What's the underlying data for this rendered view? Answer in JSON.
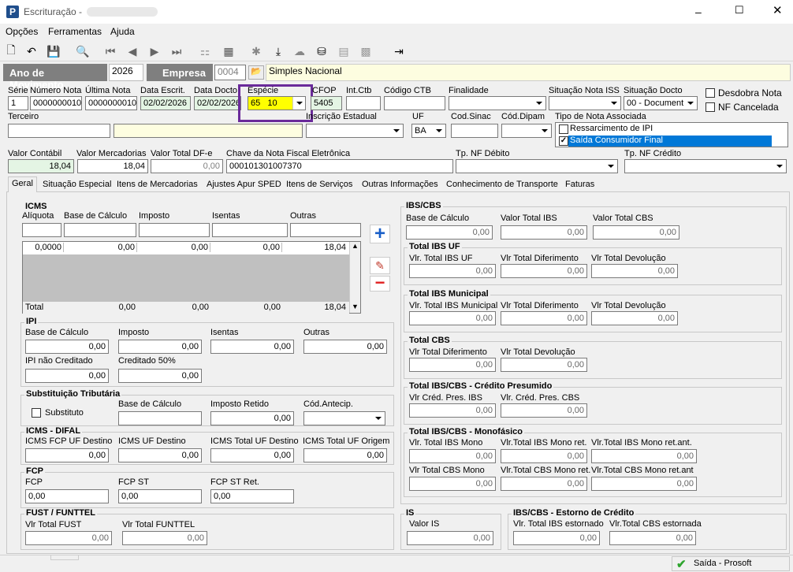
{
  "window": {
    "title": "Escrituração -"
  },
  "menu": [
    "Opções",
    "Ferramentas",
    "Ajuda"
  ],
  "header": {
    "ano_label": "Ano de Movimento",
    "ano": "2026",
    "empresa_label": "Empresa",
    "empresa_code": "0004",
    "empresa_name": "Simples Nacional"
  },
  "row1": {
    "serie_l": "Série",
    "serie": "1",
    "numnota_l": "Número Nota",
    "numnota": "0000000010",
    "ultnota_l": "Última Nota",
    "ultnota": "0000000010",
    "dtescr_l": "Data Escrit.",
    "dtescr": "02/02/2026",
    "dtdocto_l": "Data Docto",
    "dtdocto": "02/02/2026",
    "especie_l": "Espécie",
    "especie": "65   10",
    "cfop_l": "CFOP",
    "cfop": "5405",
    "intctb_l": "Int.Ctb",
    "codctb_l": "Código CTB",
    "finalidade_l": "Finalidade",
    "sitiss_l": "Situação Nota ISS",
    "sitdocto_l": "Situação Docto",
    "sitdocto": "00 - Document",
    "desdobra": "Desdobra Nota",
    "nfcanc": "NF Cancelada"
  },
  "row2": {
    "terceiro_l": "Terceiro",
    "inscr_l": "Inscrição Estadual",
    "uf_l": "UF",
    "uf": "BA",
    "codsinac_l": "Cod.Sinac",
    "coddipam_l": "Cód.Dipam",
    "tiponota_l": "Tipo de Nota Associada",
    "tipos": [
      "Ressarcimento de IPI",
      "Saída Consumidor Final"
    ]
  },
  "row3": {
    "valcont_l": "Valor Contábil",
    "valcont": "18,04",
    "valmerc_l": "Valor Mercadorias",
    "valmerc": "18,04",
    "valdfe_l": "Valor Total DF-e",
    "valdfe": "0,00",
    "chave_l": "Chave da Nota Fiscal Eletrônica",
    "chave": "000101301007370",
    "tpdeb_l": "Tp. NF Débito",
    "tpcred_l": "Tp. NF Crédito"
  },
  "tabs": [
    "Geral",
    "Situação Especial",
    "Itens de Mercadorias",
    "Ajustes Apur SPED",
    "Itens de Serviços",
    "Outras Informações",
    "Conhecimento de Transporte",
    "Faturas"
  ],
  "icms": {
    "title": "ICMS",
    "aliq_l": "Alíquota",
    "base_l": "Base de Cálculo",
    "imp_l": "Imposto",
    "isen_l": "Isentas",
    "out_l": "Outras",
    "row": [
      "0,0000",
      "0,00",
      "0,00",
      "0,00",
      "18,04"
    ],
    "total_l": "Total",
    "total": [
      "0,00",
      "0,00",
      "0,00",
      "18,04"
    ]
  },
  "ipi": {
    "title": "IPI",
    "base_l": "Base de Cálculo",
    "base": "0,00",
    "imp_l": "Imposto",
    "imp": "0,00",
    "isen_l": "Isentas",
    "isen": "0,00",
    "out_l": "Outras",
    "out": "0,00",
    "nc_l": "IPI não Creditado",
    "nc": "0,00",
    "c50_l": "Creditado 50%",
    "c50": "0,00"
  },
  "st": {
    "title": "Substituição Tributária",
    "subst": "Substituto",
    "base_l": "Base de Cálculo",
    "imp_l": "Imposto Retido",
    "imp": "0,00",
    "cod_l": "Cód.Antecip."
  },
  "difal": {
    "title": "ICMS - DIFAL",
    "a_l": "ICMS FCP UF Destino",
    "a": "0,00",
    "b_l": "ICMS UF Destino",
    "b": "0,00",
    "c_l": "ICMS Total UF Destino",
    "c": "0,00",
    "d_l": "ICMS Total UF Origem",
    "d": "0,00"
  },
  "fcp": {
    "title": "FCP",
    "a_l": "FCP",
    "a": "0,00",
    "b_l": "FCP ST",
    "b": "0,00",
    "c_l": "FCP ST Ret.",
    "c": "0,00"
  },
  "fust": {
    "title": "FUST / FUNTTEL",
    "a_l": "Vlr Total FUST",
    "a": "0,00",
    "b_l": "Vlr Total FUNTTEL",
    "b": "0,00"
  },
  "ibscbs": {
    "title": "IBS/CBS",
    "base_l": "Base de Cálculo",
    "base": "0,00",
    "ibs_l": "Valor Total IBS",
    "ibs": "0,00",
    "cbs_l": "Valor Total CBS",
    "cbs": "0,00"
  },
  "ibsuf": {
    "title": "Total IBS UF",
    "a_l": "Vlr. Total IBS UF",
    "a": "0,00",
    "b_l": "Vlr Total Diferimento",
    "b": "0,00",
    "c_l": "Vlr Total Devolução",
    "c": "0,00"
  },
  "ibsmun": {
    "title": "Total IBS Municipal",
    "a_l": "Vlr. Total IBS Municipal",
    "a": "0,00",
    "b_l": "Vlr Total Diferimento",
    "b": "0,00",
    "c_l": "Vlr Total Devolução",
    "c": "0,00"
  },
  "cbs": {
    "title": "Total CBS",
    "a_l": "Vlr Total Diferimento",
    "a": "0,00",
    "b_l": "Vlr Total Devolução",
    "b": "0,00"
  },
  "cpres": {
    "title": "Total IBS/CBS - Crédito Presumido",
    "a_l": "Vlr Créd. Pres. IBS",
    "a": "0,00",
    "b_l": "Vlr. Créd. Pres. CBS",
    "b": "0,00"
  },
  "mono": {
    "title": "Total IBS/CBS - Monofásico",
    "a_l": "Vlr. Total IBS Mono",
    "a": "0,00",
    "b_l": "Vlr.Total IBS Mono ret.",
    "b": "0,00",
    "c_l": "Vlr.Total IBS Mono ret.ant.",
    "c": "0,00",
    "d_l": "Vlr Total CBS Mono",
    "d": "0,00",
    "e_l": "Vlr.Total CBS Mono ret.",
    "e": "0,00",
    "f_l": "Vlr.Total CBS Mono ret.ant",
    "f": "0,00"
  },
  "is": {
    "title": "IS",
    "a_l": "Valor IS",
    "a": "0,00"
  },
  "estorno": {
    "title": "IBS/CBS - Estorno de Crédito",
    "a_l": "Vlr. Total IBS estornado",
    "a": "0,00",
    "b_l": "Vlr.Total CBS estornada",
    "b": "0,00"
  },
  "status": {
    "text": "Saída - Prosoft"
  }
}
